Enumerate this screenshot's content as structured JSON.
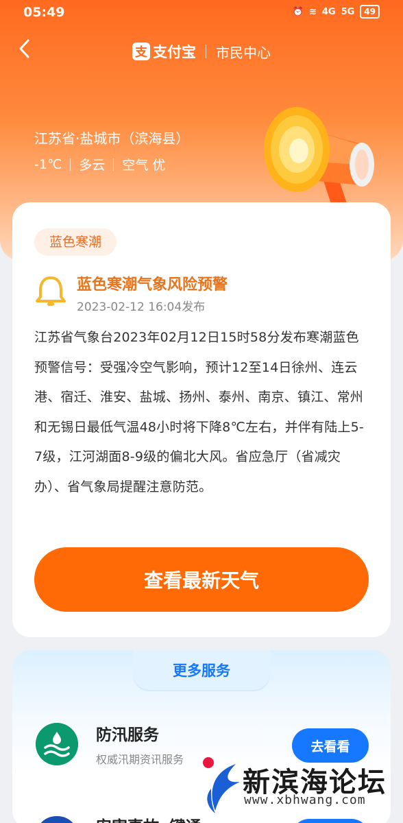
{
  "status": {
    "time": "05:49",
    "network1": "4G",
    "network2": "5G",
    "battery": "49"
  },
  "header": {
    "logo_char": "支",
    "brand": "支付宝",
    "section": "市民中心"
  },
  "location": "江苏省·盐城市（滨海县）",
  "weather": {
    "temp": "-1℃",
    "condition": "多云",
    "air": "空气 优"
  },
  "warning": {
    "tag": "蓝色寒潮",
    "title": "蓝色寒潮气象风险预警",
    "time": "2023-02-12 16:04发布",
    "body": "江苏省气象台2023年02月12日15时58分发布寒潮蓝色预警信号：受强冷空气影响，预计12至14日徐州、连云港、宿迁、淮安、盐城、扬州、泰州、南京、镇江、常州和无锡日最低气温48小时将下降8℃左右，并伴有陆上5-7级，江河湖面8-9级的偏北大风。省应急厅（省减灾办）、省气象局提醒注意防范。",
    "cta": "查看最新天气"
  },
  "more_services": {
    "title": "更多服务",
    "items": [
      {
        "title": "防汛服务",
        "desc": "权威汛期资讯服务",
        "button": "去看看"
      },
      {
        "title": "安害事故e键通"
      }
    ]
  },
  "watermark": {
    "name": "新滨海论坛",
    "url": "www.xbhwang.com"
  },
  "colors": {
    "primary": "#ff6a06",
    "accent": "#1677ff",
    "warning_text": "#e8741c"
  }
}
